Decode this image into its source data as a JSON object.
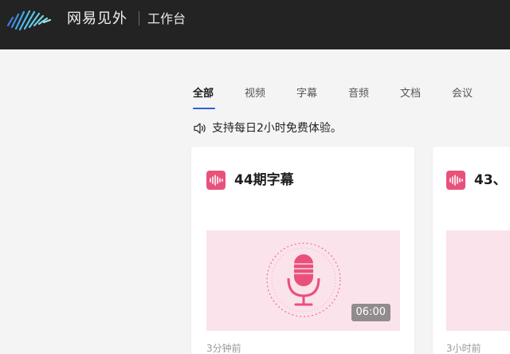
{
  "header": {
    "brand": "网易见外",
    "workspace": "工作台"
  },
  "tabs": [
    {
      "label": "全部",
      "active": true
    },
    {
      "label": "视频",
      "active": false
    },
    {
      "label": "字幕",
      "active": false
    },
    {
      "label": "音频",
      "active": false
    },
    {
      "label": "文档",
      "active": false
    },
    {
      "label": "会议",
      "active": false
    }
  ],
  "notice": {
    "icon": "speaker-icon",
    "text": "支持每日2小时免费体验。"
  },
  "cards": [
    {
      "title": "44期字幕",
      "duration": "06:00",
      "time": "3分钟前",
      "icon": "audio-wave-icon"
    },
    {
      "title": "43、",
      "time": "3小时前",
      "icon": "audio-wave-icon"
    }
  ],
  "colors": {
    "topbar": "#232323",
    "accent": "#2b63d9",
    "badge": "#e8527a",
    "thumb": "#fbe3eb"
  }
}
